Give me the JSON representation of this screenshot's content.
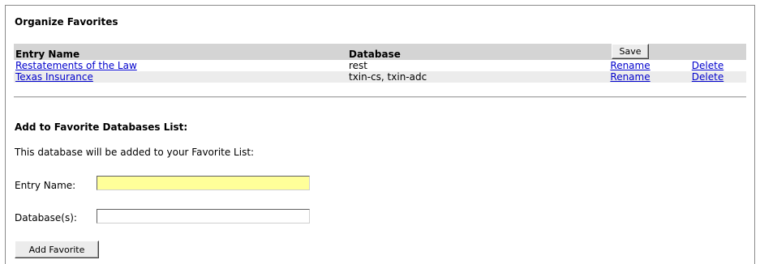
{
  "organize": {
    "title": "Organize Favorites",
    "headers": {
      "entry_name": "Entry Name",
      "database": "Database",
      "save_label": "Save"
    },
    "rows": [
      {
        "entry_name": "Restatements of the Law",
        "database": "rest",
        "rename_label": "Rename",
        "delete_label": "Delete"
      },
      {
        "entry_name": "Texas Insurance",
        "database": "txin-cs, txin-adc",
        "rename_label": "Rename",
        "delete_label": "Delete"
      }
    ]
  },
  "add_section": {
    "heading": "Add to Favorite Databases List:",
    "info": "This database will be added to your Favorite List:",
    "entry_name_label": "Entry Name:",
    "entry_name_value": "",
    "databases_label": "Database(s):",
    "databases_value": "",
    "add_button_label": "Add Favorite"
  },
  "colors": {
    "header_bg": "#d4d4d4",
    "alt_row_bg": "#ececec",
    "link": "#0000cc",
    "focused_input_bg": "#ffff99"
  }
}
